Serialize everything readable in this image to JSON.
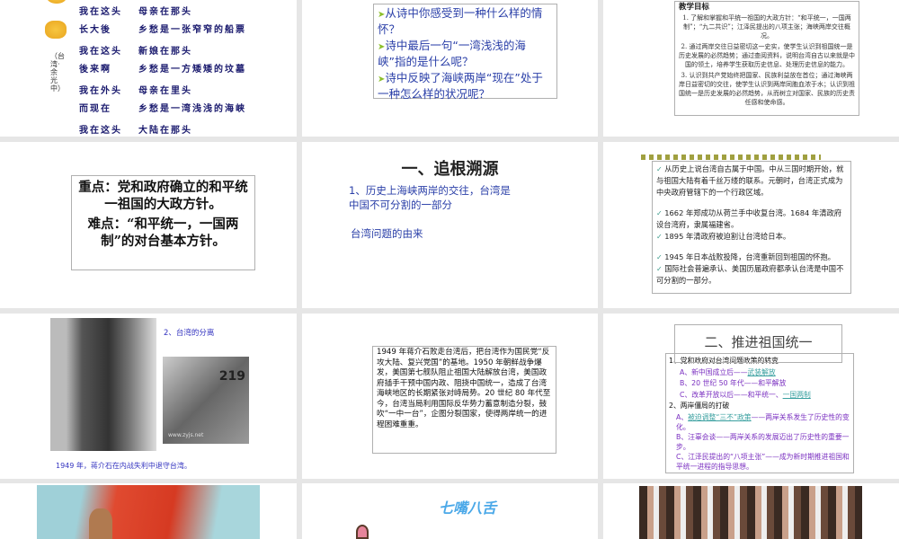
{
  "slide1": {
    "poem": [
      [
        "我在这头",
        "母亲在那头"
      ],
      [
        "长大後",
        "乡愁是一张窄窄的船票"
      ],
      [
        "我在这头",
        "新娘在那头"
      ],
      [
        "後来啊",
        "乡愁是一方矮矮的坟墓"
      ],
      [
        "我在外头",
        "母亲在里头"
      ],
      [
        "而现在",
        "乡愁是一湾浅浅的海峡"
      ],
      [
        "我在这头",
        "大陆在那头"
      ]
    ],
    "author": "（台湾·余光中）"
  },
  "slide2": {
    "questions": [
      "从诗中你感受到一种什么样的情怀？",
      "诗中最后一句“一湾浅浅的海峡”指的是什么呢？",
      "诗中反映了海峡两岸“现在”处于一种怎么样的状况呢？"
    ]
  },
  "slide3": {
    "heading": "教学目标",
    "items": [
      "1. 了解和掌握和平统一祖国的大政方针：“和平统一，一国两制”；“九二共识”；江泽民提出的八项主张；海峡两岸交往概况。",
      "2. 通过两岸交往日益密切这一史实，使学生认识到祖国统一是历史发展的必然趋势；通过查阅资料，说明台湾自古以来就是中国的领土，培养学生获取历史信息、处理历史信息的能力。",
      "3. 认识到共产党始终把国家、民族利益放在首位；通过海峡两岸日益密切的交往，使学生认识到两岸同胞血浓于水；认识到祖国统一是历史发展的必然趋势，从而树立对国家、民族的历史责任感和使命感。"
    ]
  },
  "slide4": {
    "key": "重点：党和政府确立的和平统一祖国的大政方针。",
    "difficult": "难点：“和平统一，一国两制”的对台基本方针。"
  },
  "slide5": {
    "title": "一、追根溯源",
    "line1": "1、历史上海峡两岸的交往，台湾是中国不可分割的一部分",
    "line2": "台湾问题的由来"
  },
  "slide6": {
    "items": [
      "从历史上说台湾自古属于中国。中从三国时期开始，就与祖国大陆有着千丝万缕的联系。元朝时，台湾正式成为中央政府管辖下的一个行政区域。",
      "1662 年郑成功从荷兰手中收复台湾。1684 年清政府设台湾府，隶属福建省。",
      "1895 年清政府被迫割让台湾给日本。",
      "1945 年日本战败投降，台湾重新回到祖国的怀抱。",
      "国际社会普遍承认、美国历届政府都承认台湾是中国不可分割的一部分。"
    ]
  },
  "slide7": {
    "title": "2、台湾的分离",
    "caption": "1949 年，蒋介石在内战失利中退守台湾。",
    "plane_number": "219",
    "watermark": "www.zyjs.net"
  },
  "slide8": {
    "text": "1949 年蒋介石败走台湾后，把台湾作为国民党“反攻大陆、复兴党国”的基地。1950 年朝鲜战争爆发，美国第七舰队阻止祖国大陆解放台湾，美国政府插手干预中国内政、阻挠中国统一，造成了台湾海峡地区的长期紧张对峙局势。20 世纪 80 年代至今，台湾当局利用国际反华势力蓄意制造分裂，鼓吹“一中一台”，企图分裂国家，使得两岸统一的进程困难重重。"
  },
  "slide9": {
    "title": "二、推进祖国统一",
    "s1": "1、党和政府对台湾问题政策的转变",
    "a1": "A、新中国成立后——",
    "a1link": "武装解放",
    "b1": "B、20 世纪 50 年代——和平解放",
    "c1": "C、改革开放以后——和平统一、",
    "c1link": "一国两制",
    "s2": "2、两岸僵局的打破",
    "a2pre": "A、",
    "a2link": "被迫调整“三不”政策",
    "a2": "——两岸关系发生了历史性的变化。",
    "b2": "B、汪辜会谈——两岸关系的发展迈出了历史性的重要一步。",
    "c2": "C、江泽民提出的“八项主张”——成为新时期推进祖国和平统一进程的指导思想。"
  },
  "slide11": {
    "title": "七嘴八舌"
  }
}
